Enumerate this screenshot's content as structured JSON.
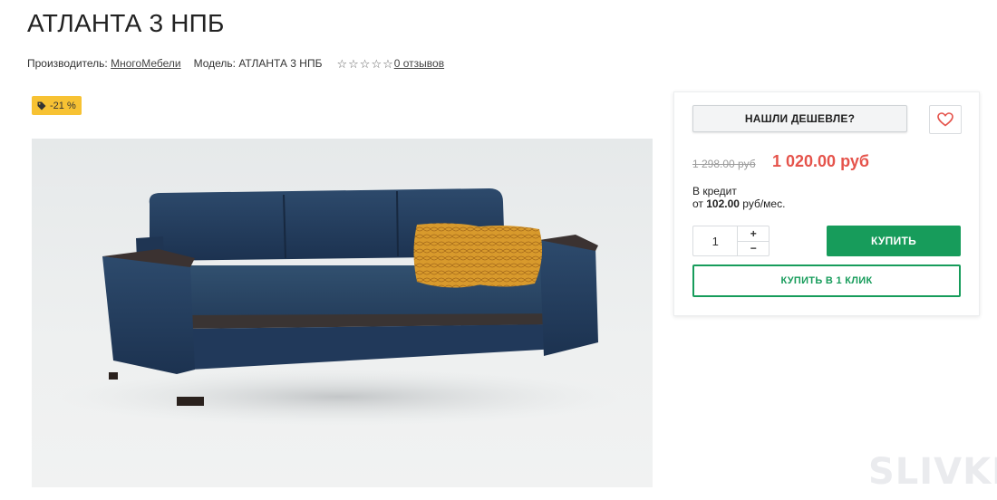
{
  "product": {
    "title": "АТЛАНТА 3 НПБ",
    "manufacturer_label": "Производитель:",
    "manufacturer_value": "МногоМебели",
    "model_label": "Модель:",
    "model_value": "АТЛАНТА 3 НПБ",
    "rating": 0,
    "rating_max": 5,
    "reviews_link": "0 отзывов",
    "discount_badge": "-21 %"
  },
  "purchase": {
    "cheaper_button": "НАШЛИ ДЕШЕВЛЕ?",
    "old_price": "1 298.00 руб",
    "new_price": "1 020.00 руб",
    "credit_label": "В кредит",
    "credit_prefix": "от",
    "credit_amount": "102.00",
    "credit_suffix": "руб/мес.",
    "quantity": "1",
    "qty_plus": "+",
    "qty_minus": "−",
    "buy_button": "КУПИТЬ",
    "one_click_button": "КУПИТЬ В 1 КЛИК"
  },
  "watermark": "SLIVKI",
  "colors": {
    "accent_green": "#179c5b",
    "price_red": "#e5534b",
    "badge_yellow": "#f7c233",
    "heart_red": "#e5534b"
  },
  "icons": {
    "badge": "tag-icon",
    "favorite": "heart-icon",
    "rating": "star-outline-icon"
  }
}
